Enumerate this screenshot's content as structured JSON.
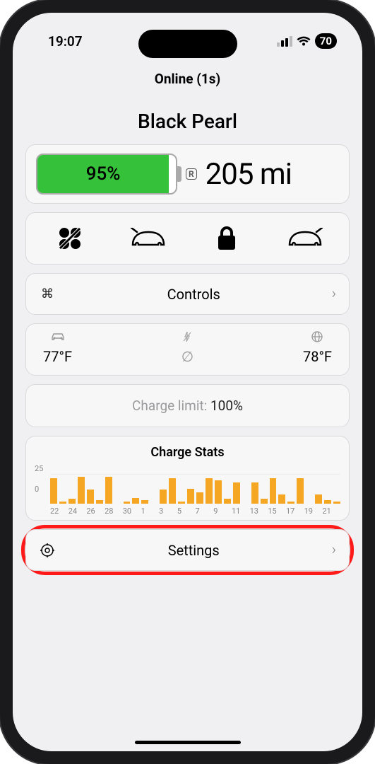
{
  "status": {
    "time": "19:07",
    "battery": "70"
  },
  "header": {
    "online": "Online (1s)"
  },
  "vehicle": {
    "name": "Black Pearl"
  },
  "battery": {
    "percent": "95%",
    "fill": 95,
    "rated": "R",
    "range": "205 mi"
  },
  "controls": {
    "label": "Controls"
  },
  "temps": {
    "inside": "77°F",
    "mid": "∅",
    "outside": "78°F"
  },
  "limit": {
    "label": "Charge limit: ",
    "value": "100%"
  },
  "settings": {
    "label": "Settings"
  },
  "chart_data": {
    "type": "bar",
    "title": "Charge Stats",
    "ylim": [
      0,
      25
    ],
    "yticks": [
      25,
      0
    ],
    "categories": [
      "22",
      "24",
      "26",
      "28",
      "30",
      "1",
      "3",
      "5",
      "7",
      "9",
      "11",
      "13",
      "15",
      "17",
      "19",
      "21"
    ],
    "values": [
      22,
      2,
      4,
      23,
      12,
      3,
      23,
      0,
      2,
      5,
      3,
      0,
      12,
      22,
      2,
      13,
      10,
      22,
      20,
      4,
      18,
      0,
      18,
      4,
      22,
      8,
      2,
      22,
      0,
      8,
      3,
      2
    ],
    "color": "#f5a623"
  }
}
